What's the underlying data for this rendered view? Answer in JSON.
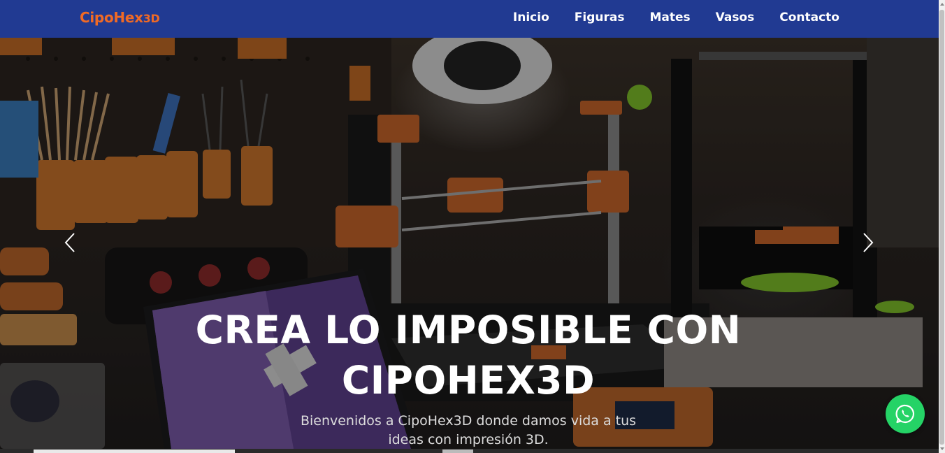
{
  "brand": {
    "name": "CipoHex",
    "suffix": "3D",
    "color": "#f06a25"
  },
  "nav": {
    "background": "#213a92",
    "items": [
      {
        "label": "Inicio"
      },
      {
        "label": "Figuras"
      },
      {
        "label": "Mates"
      },
      {
        "label": "Vasos"
      },
      {
        "label": "Contacto"
      }
    ]
  },
  "hero": {
    "title_line1": "CREA LO IMPOSIBLE CON",
    "title_line2": "CIPOHEX3D",
    "subtitle_line1": "Bienvenidos a CipoHex3D donde damos vida a tus",
    "subtitle_line2": "ideas con impresión 3D.",
    "image_description_icon": "3d-printer-workshop-image"
  },
  "carousel": {
    "prev_icon": "chevron-left-icon",
    "next_icon": "chevron-right-icon"
  },
  "whatsapp": {
    "icon": "whatsapp-icon",
    "color": "#25d366"
  }
}
